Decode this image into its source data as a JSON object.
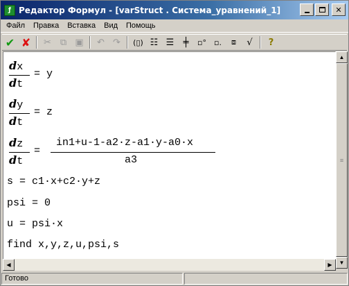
{
  "window": {
    "title": "Редактор Формул - [varStruct . Система_уравнений_1]",
    "icon": "formula-app-icon",
    "controls": [
      "minimize",
      "maximize",
      "close"
    ]
  },
  "menu": [
    "Файл",
    "Правка",
    "Вставка",
    "Вид",
    "Помощь"
  ],
  "toolbar": {
    "icons": [
      "check-icon",
      "cross-icon",
      "cut-icon",
      "copy-icon",
      "paste-icon",
      "undo-icon",
      "redo-icon",
      "matrix-icon",
      "row-insert-icon",
      "col-insert-icon",
      "add-col-icon",
      "insert-left-icon",
      "insert-right-icon",
      "sqrt-icon",
      "help-icon"
    ]
  },
  "equations": {
    "eq1": {
      "d": "d",
      "num_var": "x",
      "den_var": "t",
      "rhs": "= y"
    },
    "eq2": {
      "d": "d",
      "num_var": "y",
      "den_var": "t",
      "rhs": "= z"
    },
    "eq3": {
      "d": "d",
      "num_var": "z",
      "den_var": "t",
      "eq": "=",
      "rhs_num": "in1+u-1-a2·z-a1·y-a0·x",
      "rhs_den": "a3"
    },
    "line4": "s = c1·x+c2·y+z",
    "line5": "psi = 0",
    "line6": "u = psi·x",
    "line7": "find x,y,z,u,psi,s"
  },
  "status": {
    "text": "Готово"
  }
}
